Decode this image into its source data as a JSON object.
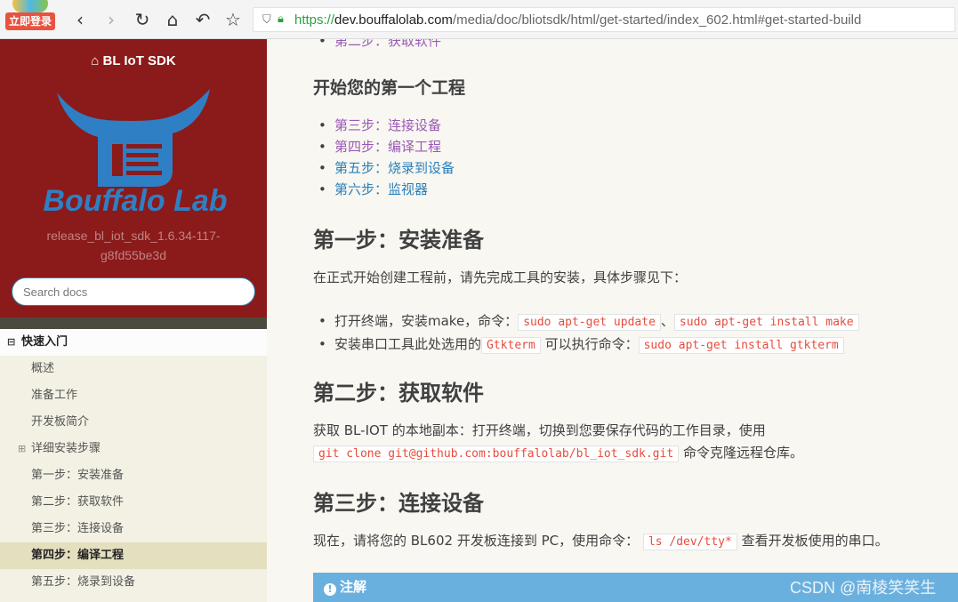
{
  "browser": {
    "login_badge": "立即登录",
    "back_icon": "‹",
    "forward_icon": "›",
    "reload_icon": "↻",
    "home_icon": "⌂",
    "undo_icon": "↶",
    "star_icon": "☆",
    "url_scheme": "https://",
    "url_host": "dev.bouffalolab.com",
    "url_path": "/media/doc/bliotsdk/html/get-started/index_602.html#get-started-build"
  },
  "sidebar": {
    "project_title": "BL IoT SDK",
    "logo_text": "Bouffalo Lab",
    "version_line1": "release_bl_iot_sdk_1.6.34-117-",
    "version_line2": "g8fd55be3d",
    "search_placeholder": "Search docs",
    "caption": "快速入门",
    "items": [
      {
        "label": "概述"
      },
      {
        "label": "准备工作"
      },
      {
        "label": "开发板简介"
      },
      {
        "label": "详细安装步骤"
      },
      {
        "label": "第一步：安装准备"
      },
      {
        "label": "第二步：获取软件"
      },
      {
        "label": "第三步：连接设备"
      },
      {
        "label": "第四步：编译工程"
      },
      {
        "label": "第五步：烧录到设备"
      }
    ]
  },
  "main": {
    "top_link": "第二步：获取软件",
    "first_project_heading": "开始您的第一个工程",
    "project_links": [
      "第三步：连接设备",
      "第四步：编译工程",
      "第五步：烧录到设备",
      "第六步：监视器"
    ],
    "step1": {
      "heading": "第一步：安装准备",
      "intro": "在正式开始创建工程前，请先完成工具的安装，具体步骤见下：",
      "bullet1_text": "打开终端，安装make，命令：",
      "bullet1_code1": "sudo apt-get update",
      "bullet1_sep": "、",
      "bullet1_code2": "sudo apt-get install make",
      "bullet2_text1": "安装串口工具此处选用的",
      "bullet2_code1": "Gtkterm",
      "bullet2_text2": "可以执行命令：",
      "bullet2_code2": "sudo apt-get install gtkterm"
    },
    "step2": {
      "heading": "第二步：获取软件",
      "line1": "获取 BL-IOT 的本地副本：打开终端，切换到您要保存代码的工作目录，使用",
      "code": "git clone git@github.com:bouffalolab/bl_iot_sdk.git",
      "line2": "命令克隆远程仓库。"
    },
    "step3": {
      "heading": "第三步：连接设备",
      "text1": "现在，请将您的 BL602 开发板连接到 PC，使用命令：",
      "code": "ls /dev/tty*",
      "text2": "查看开发板使用的串口。"
    },
    "note_title": "注解",
    "watermark": "CSDN @南棱笑笑生"
  }
}
